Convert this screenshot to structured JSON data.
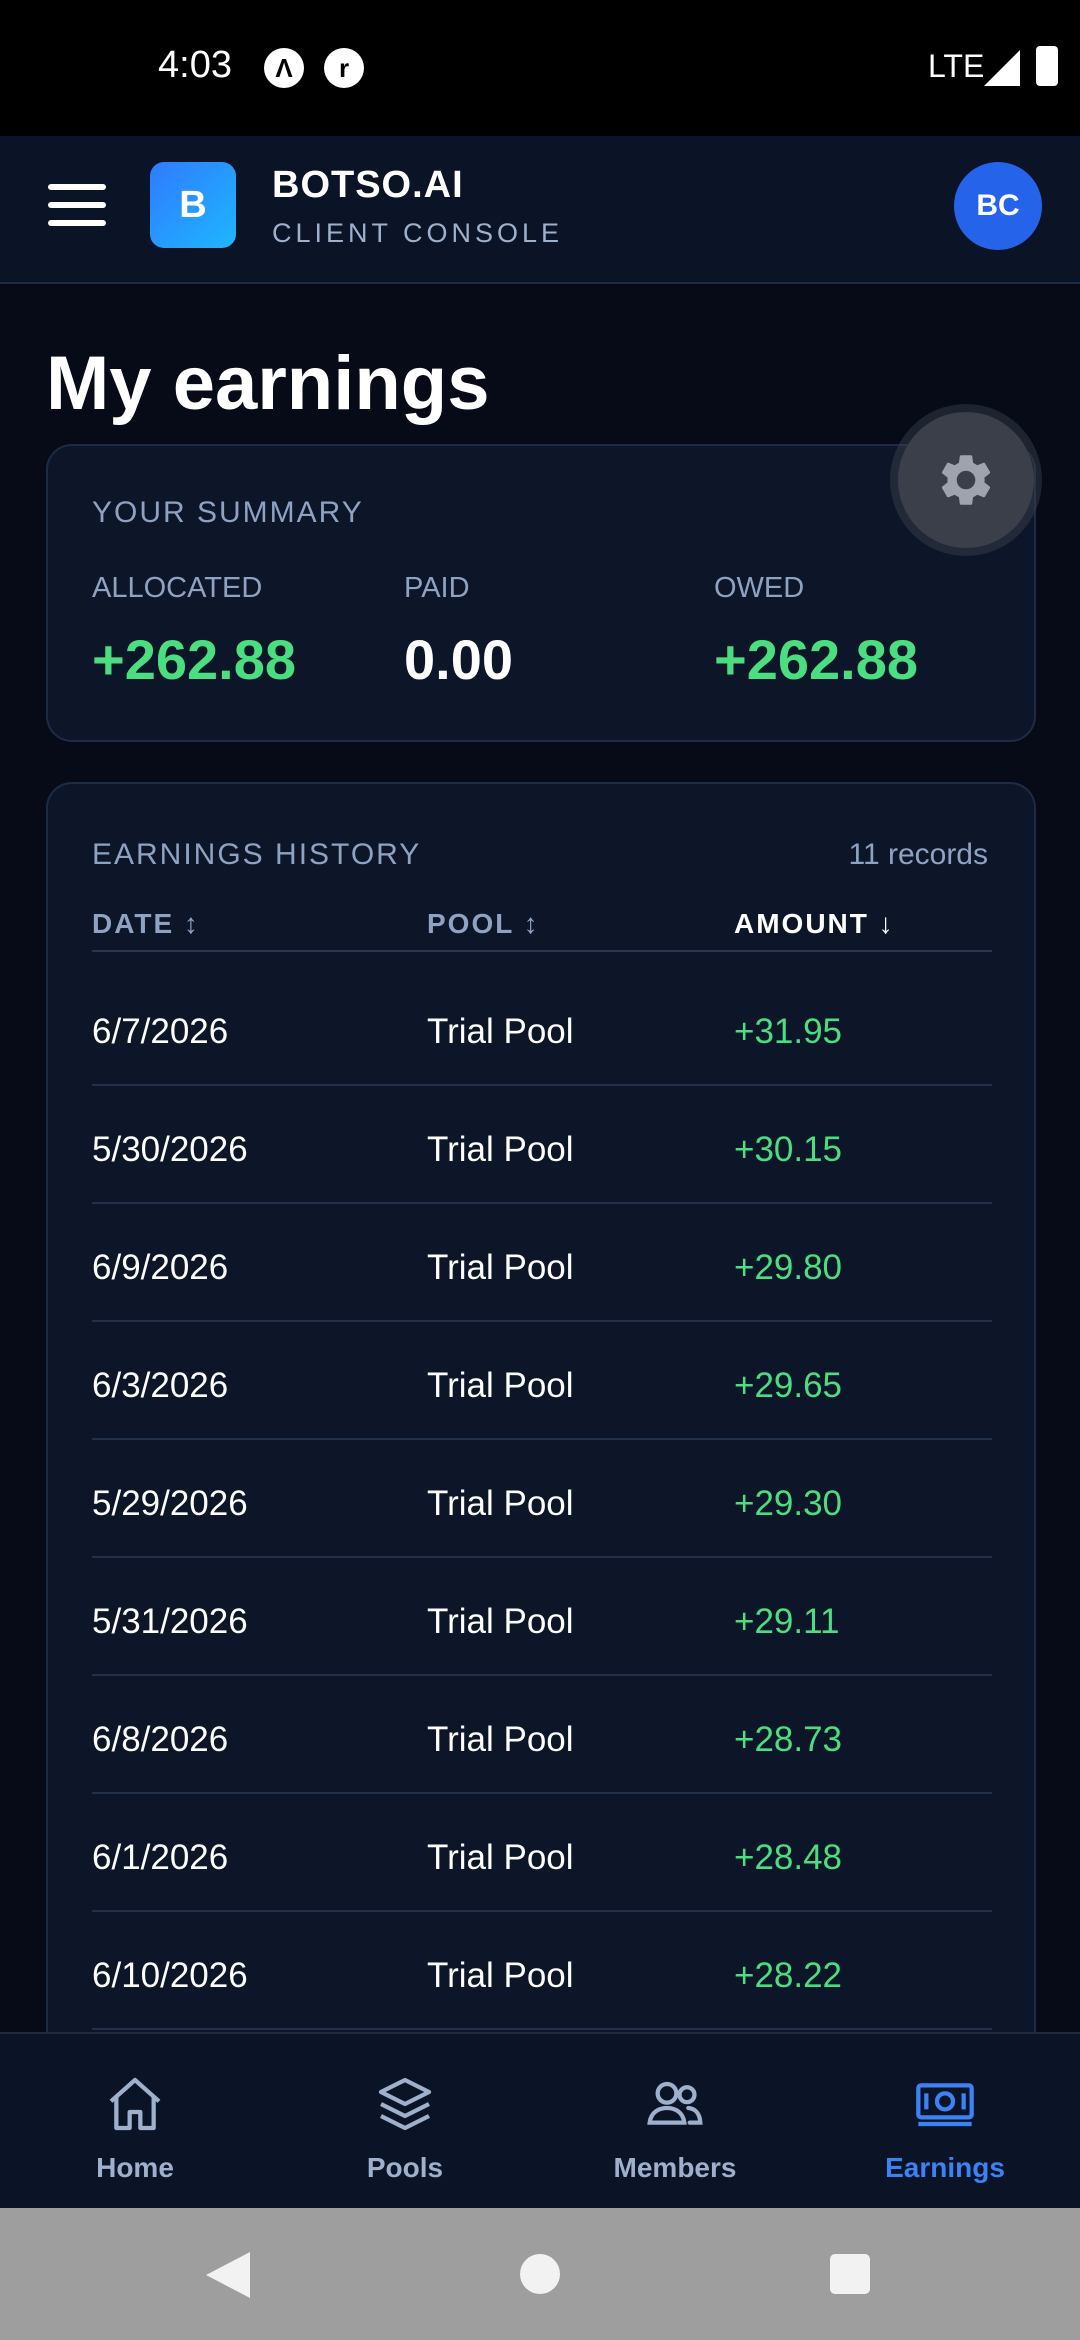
{
  "status": {
    "time": "4:03",
    "network": "LTE"
  },
  "app": {
    "logo_letter": "B",
    "name": "BOTSO.AI",
    "subtitle": "CLIENT CONSOLE",
    "avatar": "BC"
  },
  "page": {
    "title": "My earnings"
  },
  "summary": {
    "label": "YOUR SUMMARY",
    "allocated_label": "ALLOCATED",
    "allocated": "+262.88",
    "paid_label": "PAID",
    "paid": "0.00",
    "owed_label": "OWED",
    "owed": "+262.88"
  },
  "history": {
    "label": "EARNINGS HISTORY",
    "count": "11 records",
    "columns": {
      "date": "DATE ↕",
      "pool": "POOL ↕",
      "amount": "AMOUNT ↓"
    },
    "rows": [
      {
        "date": "6/7/2026",
        "pool": "Trial Pool",
        "amount": "+31.95"
      },
      {
        "date": "5/30/2026",
        "pool": "Trial Pool",
        "amount": "+30.15"
      },
      {
        "date": "6/9/2026",
        "pool": "Trial Pool",
        "amount": "+29.80"
      },
      {
        "date": "6/3/2026",
        "pool": "Trial Pool",
        "amount": "+29.65"
      },
      {
        "date": "5/29/2026",
        "pool": "Trial Pool",
        "amount": "+29.30"
      },
      {
        "date": "5/31/2026",
        "pool": "Trial Pool",
        "amount": "+29.11"
      },
      {
        "date": "6/8/2026",
        "pool": "Trial Pool",
        "amount": "+28.73"
      },
      {
        "date": "6/1/2026",
        "pool": "Trial Pool",
        "amount": "+28.48"
      },
      {
        "date": "6/10/2026",
        "pool": "Trial Pool",
        "amount": "+28.22"
      }
    ]
  },
  "nav": [
    {
      "label": "Home",
      "icon": "home-icon"
    },
    {
      "label": "Pools",
      "icon": "layers-icon"
    },
    {
      "label": "Members",
      "icon": "users-icon"
    },
    {
      "label": "Earnings",
      "icon": "cash-icon",
      "active": true
    }
  ],
  "colors": {
    "accent": "#3b82f6",
    "positive": "#4ade80",
    "background": "#060b17",
    "card": "#0d1528"
  }
}
